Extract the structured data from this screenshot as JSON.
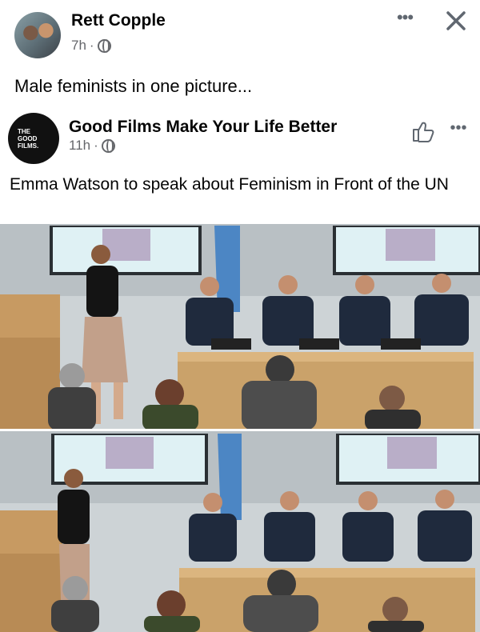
{
  "post": {
    "author": "Rett Copple",
    "time": "7h",
    "separator": "·",
    "text": "Male feminists in one picture...",
    "more_label": "•••"
  },
  "shared": {
    "page_name": "Good Films Make Your Life Better",
    "page_avatar_lines": [
      "THE",
      "GOOD",
      "FILMS."
    ],
    "time": "11h",
    "separator": "·",
    "text": "Emma Watson to speak about Feminism in Front of the UN",
    "more_label": "•••"
  },
  "icons": {
    "privacy": "globe-icon",
    "close": "close-icon",
    "like": "thumbs-up-icon",
    "more": "more-icon"
  },
  "colors": {
    "text_primary": "#050505",
    "text_secondary": "#65676b",
    "background": "#ffffff"
  }
}
